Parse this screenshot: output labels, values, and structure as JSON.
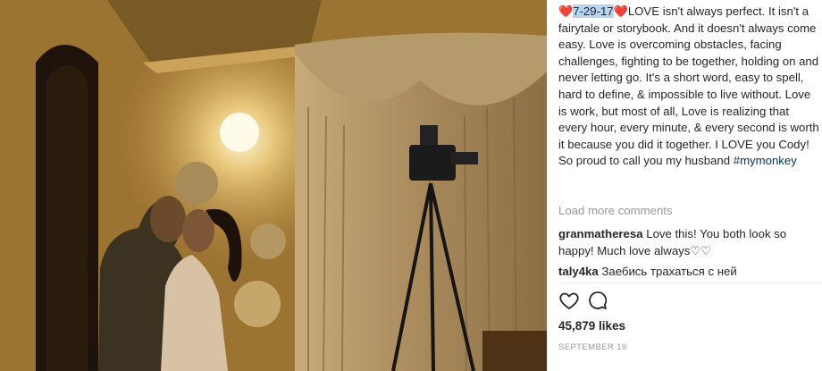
{
  "post": {
    "caption": {
      "heart_left": "❤️",
      "date": "7-29-17",
      "heart_right": "❤️",
      "text": "LOVE isn't always perfect. It isn't a fairytale or storybook. And it doesn't always come easy. Love is overcoming obstacles, facing challenges, fighting to be together, holding on and never letting go. It's a short word, easy to spell, hard to define, & impossible to live without. Love is work, but most of all, Love is realizing that every hour, every minute, & every second is worth it because you did it together. I LOVE you Cody! So proud to call you my husband ",
      "hashtag": "#mymonkey"
    },
    "load_more": "Load more comments",
    "comments": [
      {
        "user": "granmatheresa",
        "text": "Love this! You both look so happy! Much love always♡♡"
      },
      {
        "user": "taly4ka",
        "text": "Заебись трахаться с ней"
      }
    ],
    "actions": {
      "like_icon": "heart-outline-icon",
      "comment_icon": "speech-bubble-icon"
    },
    "likes": "45,879 likes",
    "date_posted": "SEPTEMBER 19"
  },
  "colors": {
    "accent_link": "#003569",
    "muted": "#999999",
    "heart": "#e0302e",
    "selection": "#b5d5f5"
  }
}
